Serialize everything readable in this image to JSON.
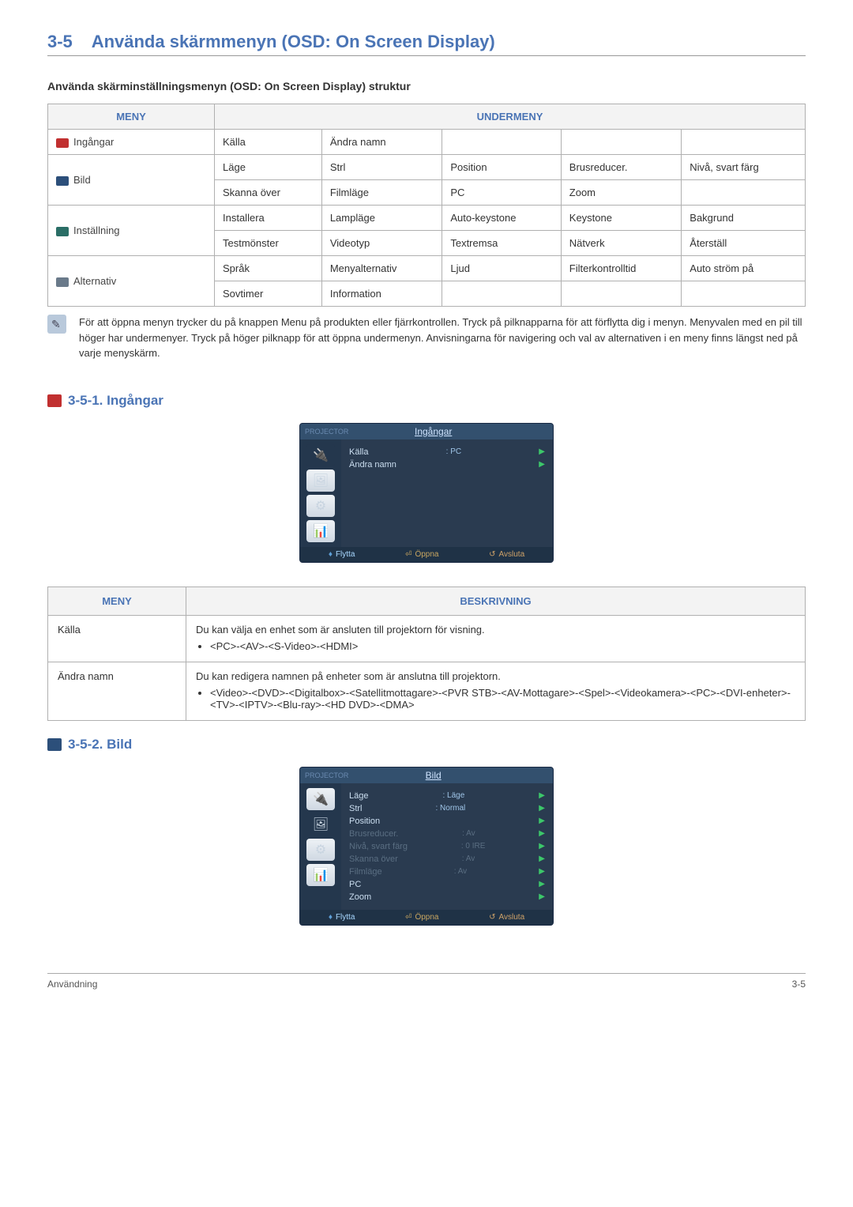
{
  "title": {
    "num": "3-5",
    "text": "Använda skärmmenyn (OSD: On Screen Display)"
  },
  "structure_heading": "Använda skärminställningsmenyn (OSD: On Screen Display) struktur",
  "menu_table": {
    "head_menu": "MENY",
    "head_sub": "UNDERMENY",
    "rows": [
      {
        "menu": "Ingångar",
        "cells": [
          "Källa",
          "Ändra namn",
          "",
          "",
          ""
        ]
      },
      {
        "menu": "Bild",
        "cells": [
          "Läge",
          "Strl",
          "Position",
          "Brusreducer.",
          "Nivå, svart färg"
        ]
      },
      {
        "menu": "",
        "cells": [
          "Skanna över",
          "Filmläge",
          "PC",
          "Zoom",
          ""
        ]
      },
      {
        "menu": "Inställning",
        "cells": [
          "Installera",
          "Lampläge",
          "Auto-keystone",
          "Keystone",
          "Bakgrund"
        ]
      },
      {
        "menu": "",
        "cells": [
          "Testmönster",
          "Videotyp",
          "Textremsa",
          "Nätverk",
          "Återställ"
        ]
      },
      {
        "menu": "Alternativ",
        "cells": [
          "Språk",
          "Menyalternativ",
          "Ljud",
          "Filterkontrolltid",
          "Auto ström på"
        ]
      },
      {
        "menu": "",
        "cells": [
          "Sovtimer",
          "Information",
          "",
          "",
          ""
        ]
      }
    ]
  },
  "note": "För att öppna menyn trycker du på knappen Menu på produkten eller fjärrkontrollen. Tryck på pilknapparna för att förflytta dig i menyn. Menyvalen med en pil till höger har undermenyer. Tryck på höger pilknapp för att öppna undermenyn. Anvisningarna för navigering och val av alternativen i en meny finns längst ned på varje menyskärm.",
  "sec351": {
    "heading": "3-5-1. Ingångar",
    "osd": {
      "projector": "PROJECTOR",
      "title": "Ingångar",
      "items": [
        {
          "label": "Källa",
          "value": ": PC"
        },
        {
          "label": "Ändra namn",
          "value": ""
        }
      ],
      "bottom": {
        "move": "Flytta",
        "open": "Öppna",
        "exit": "Avsluta"
      }
    },
    "desc": {
      "head_menu": "MENY",
      "head_desc": "BESKRIVNING",
      "rows": [
        {
          "label": "Källa",
          "text": "Du kan välja en enhet som är ansluten till projektorn för visning.",
          "bullet": "<PC>-<AV>-<S-Video>-<HDMI>"
        },
        {
          "label": "Ändra namn",
          "text": "Du kan redigera namnen på enheter som är anslutna till projektorn.",
          "bullet": "<Video>-<DVD>-<Digitalbox>-<Satellitmottagare>-<PVR STB>-<AV-Mottagare>-<Spel>-<Videokamera>-<PC>-<DVI-enheter>-<TV>-<IPTV>-<Blu-ray>-<HD DVD>-<DMA>"
        }
      ]
    }
  },
  "sec352": {
    "heading": "3-5-2. Bild",
    "osd": {
      "projector": "PROJECTOR",
      "title": "Bild",
      "items": [
        {
          "label": "Läge",
          "value": ": Läge",
          "dim": false
        },
        {
          "label": "Strl",
          "value": ": Normal",
          "dim": false
        },
        {
          "label": "Position",
          "value": "",
          "dim": false
        },
        {
          "label": "Brusreducer.",
          "value": ": Av",
          "dim": true
        },
        {
          "label": "Nivå, svart färg",
          "value": ": 0 IRE",
          "dim": true
        },
        {
          "label": "Skanna över",
          "value": ": Av",
          "dim": true
        },
        {
          "label": "Filmläge",
          "value": ": Av",
          "dim": true
        },
        {
          "label": "PC",
          "value": "",
          "dim": false
        },
        {
          "label": "Zoom",
          "value": "",
          "dim": false
        }
      ],
      "bottom": {
        "move": "Flytta",
        "open": "Öppna",
        "exit": "Avsluta"
      }
    }
  },
  "footer": {
    "left": "Användning",
    "right": "3-5"
  }
}
